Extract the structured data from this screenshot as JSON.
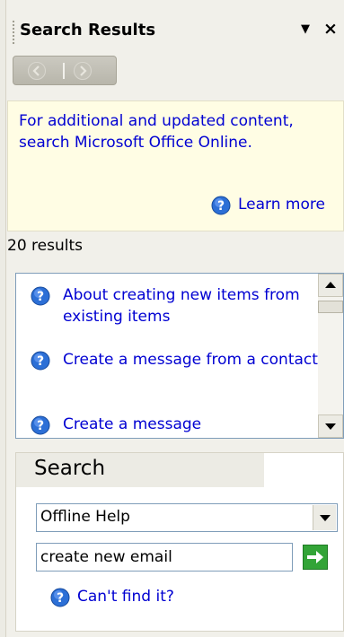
{
  "pane": {
    "title": "Search Results",
    "dropdown_icon": "triangle-down-icon",
    "close_icon": "close-x-icon"
  },
  "nav": {
    "back_icon": "back-arrow-icon",
    "forward_icon": "forward-arrow-icon"
  },
  "info": {
    "text": "For additional and updated content, search Microsoft Office Online.",
    "learn_more": "Learn more"
  },
  "results": {
    "count": "20 results",
    "items": [
      {
        "label": "About creating new items from existing items"
      },
      {
        "label": "Create a message from a contact"
      },
      {
        "label": "Create a message"
      }
    ]
  },
  "search": {
    "heading": "Search",
    "scope_value": "Offline Help",
    "query_value": "create new email",
    "cant_find": "Can't find it?"
  },
  "colors": {
    "link": "#0000d2",
    "info_bg": "#fffde4",
    "go_button": "#33a437"
  }
}
